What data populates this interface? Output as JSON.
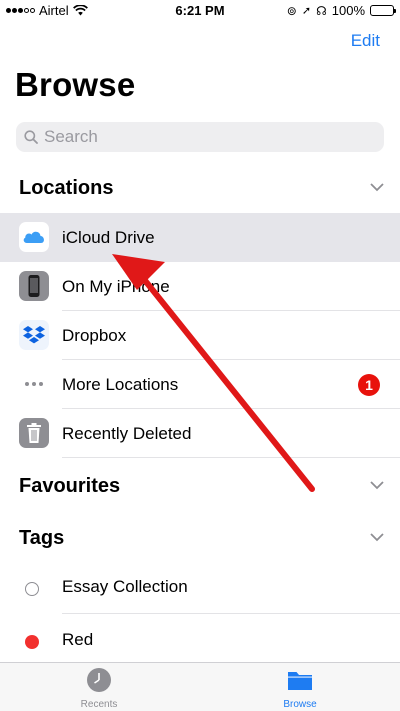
{
  "status_bar": {
    "carrier": "Airtel",
    "time": "6:21 PM",
    "battery": "100%"
  },
  "header": {
    "edit_label": "Edit",
    "title": "Browse"
  },
  "search": {
    "placeholder": "Search"
  },
  "sections": {
    "locations": "Locations",
    "favourites": "Favourites",
    "tags": "Tags"
  },
  "locations": [
    {
      "label": "iCloud Drive",
      "icon": "icloud-icon",
      "selected": true
    },
    {
      "label": "On My iPhone",
      "icon": "iphone-icon"
    },
    {
      "label": "Dropbox",
      "icon": "dropbox-icon"
    },
    {
      "label": "More Locations",
      "icon": "more-icon",
      "badge": "1"
    },
    {
      "label": "Recently Deleted",
      "icon": "trash-icon"
    }
  ],
  "tags": [
    {
      "label": "Essay Collection",
      "color": "#ffffff"
    },
    {
      "label": "Red",
      "color": "#f2302e"
    }
  ],
  "tabbar": {
    "recents": "Recents",
    "browse": "Browse"
  },
  "colors": {
    "accent": "#1e7cf2",
    "badge": "#e8120c",
    "arrow": "#e01818"
  }
}
